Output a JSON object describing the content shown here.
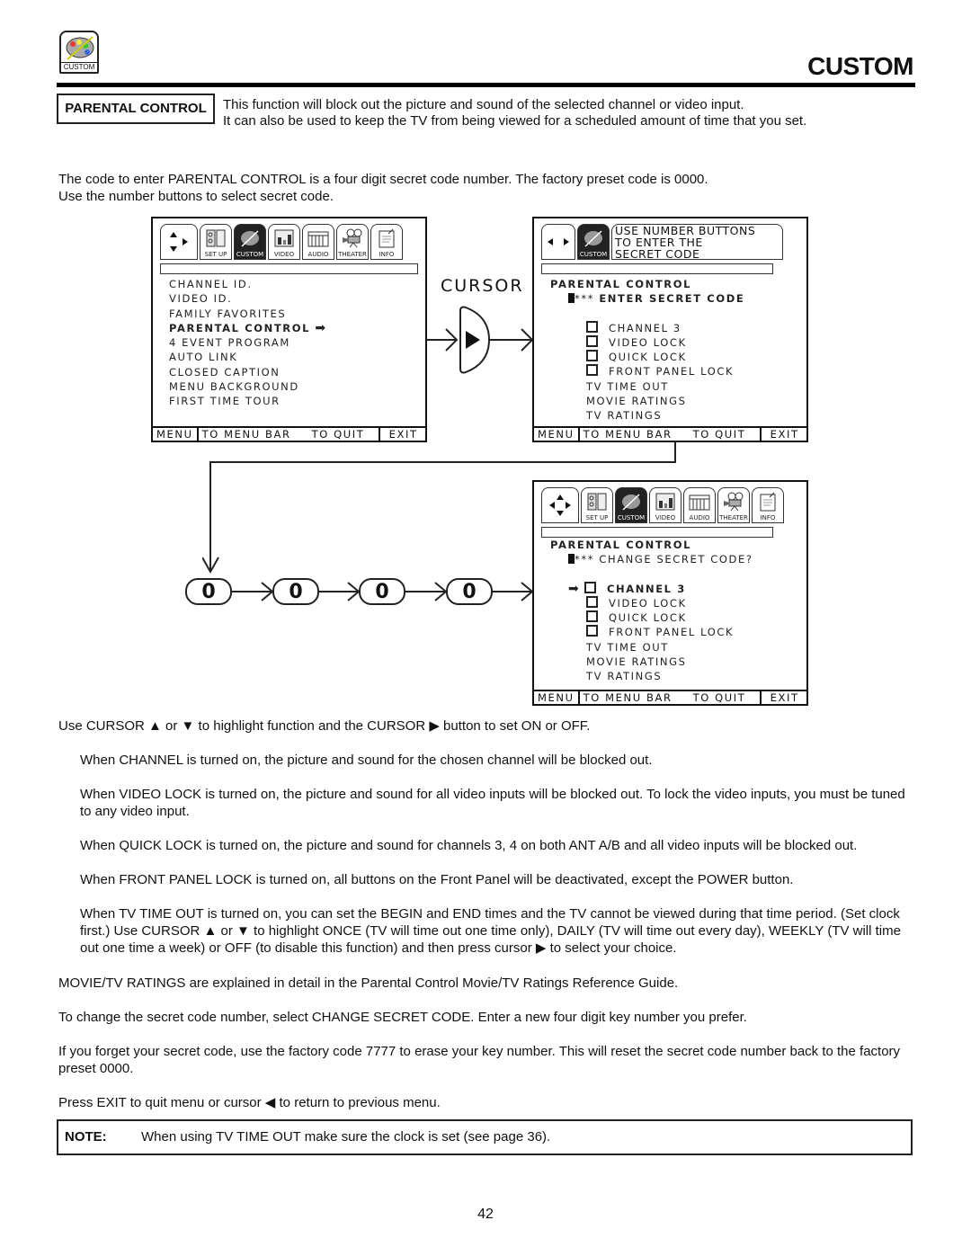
{
  "header": {
    "icon_label": "CUSTOM",
    "title": "CUSTOM"
  },
  "section": {
    "label": "PARENTAL CONTROL",
    "intro_line1": "This function will block out the picture and sound of the selected channel or video input.",
    "intro_line2": "It can also be used to keep the TV from being viewed for a scheduled amount of time that you set."
  },
  "code_intro": {
    "line1": "The code to enter PARENTAL CONTROL is a four digit secret code number.  The factory preset code is 0000.",
    "line2": "Use the number buttons to select secret code."
  },
  "tabs": [
    "SET UP",
    "CUSTOM",
    "VIDEO",
    "AUDIO",
    "THEATER",
    "INFO"
  ],
  "screen1": {
    "items": [
      "CHANNEL ID.",
      "VIDEO ID.",
      "FAMILY FAVORITES",
      "PARENTAL CONTROL",
      "4 EVENT PROGRAM",
      "AUTO LINK",
      "CLOSED CAPTION",
      "MENU BACKGROUND",
      "FIRST TIME TOUR"
    ],
    "selected_index": 3
  },
  "cursor_label": "CURSOR",
  "screen2": {
    "prompt_line1": "USE NUMBER BUTTONS",
    "prompt_line2": "TO ENTER THE",
    "prompt_line3": "SECRET CODE",
    "tab_label": "CUSTOM",
    "heading": "PARENTAL CONTROL",
    "code_mask": "***",
    "code_prompt": "ENTER SECRET CODE",
    "check_items": [
      "CHANNEL 3",
      "VIDEO LOCK",
      "QUICK LOCK",
      "FRONT PANEL LOCK"
    ],
    "plain_items": [
      "TV TIME OUT",
      "MOVIE RATINGS",
      "TV RATINGS"
    ]
  },
  "screen3": {
    "heading": "PARENTAL CONTROL",
    "code_mask": "***",
    "code_prompt": "CHANGE SECRET CODE?",
    "check_items": [
      "CHANNEL 3",
      "VIDEO LOCK",
      "QUICK LOCK",
      "FRONT PANEL LOCK"
    ],
    "plain_items": [
      "TV TIME OUT",
      "MOVIE RATINGS",
      "TV RATINGS"
    ],
    "selected_index": 0
  },
  "footer": {
    "menu": "MENU",
    "to_menu_bar": "TO MENU BAR",
    "to_quit": "TO QUIT",
    "exit": "EXIT"
  },
  "digits": [
    "0",
    "0",
    "0",
    "0"
  ],
  "instructions": {
    "cursor_use": "Use CURSOR ▲ or ▼ to highlight function and the CURSOR ▶ button to set ON or OFF.",
    "channel": "When CHANNEL is turned on, the picture and sound for the chosen channel will be blocked out.",
    "video_lock": "When VIDEO LOCK is turned on, the picture and sound for all video inputs will be blocked out. To lock the video inputs, you must be tuned to any video input.",
    "quick_lock": "When QUICK LOCK is turned on, the picture and sound for channels 3, 4 on both ANT A/B and all video inputs will be blocked out.",
    "front_panel": "When FRONT PANEL LOCK is turned on, all buttons on the Front Panel will be deactivated, except the POWER button.",
    "tv_time_out": "When TV TIME OUT is turned on, you can set the BEGIN and END times and the TV cannot be viewed during that time period. (Set clock first.) Use CURSOR ▲ or ▼ to highlight ONCE (TV will time out one time only), DAILY (TV will time out every day), WEEKLY (TV will time out one time a week) or OFF (to disable this function) and then press cursor ▶ to select your choice.",
    "ratings": "MOVIE/TV RATINGS are explained in detail in the Parental Control Movie/TV Ratings Reference Guide.",
    "change_code": "To change the secret code number, select CHANGE SECRET CODE.  Enter a new four digit key number you prefer.",
    "forget_code": "If you forget your secret code, use the factory code 7777 to erase your key number. This will reset the secret code number back to the factory preset 0000.",
    "exit": "Press EXIT to quit menu or cursor ◀ to return to previous menu."
  },
  "note": {
    "label": "NOTE:",
    "text": "When using TV TIME OUT make sure the clock is set (see page 36)."
  },
  "page_number": "42"
}
